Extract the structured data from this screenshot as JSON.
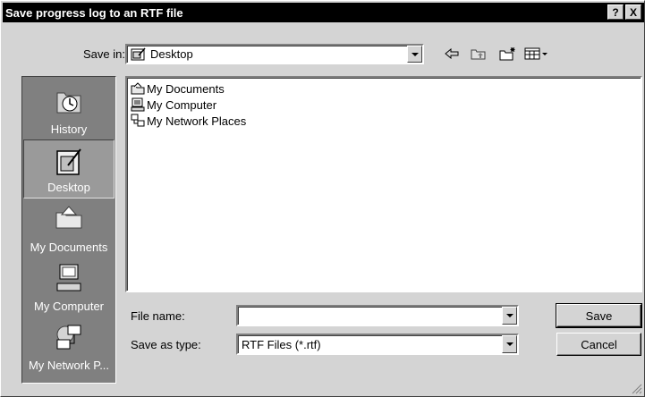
{
  "window": {
    "title": "Save progress log to an RTF file"
  },
  "titlebar_buttons": {
    "help": "?",
    "close": "X"
  },
  "save_in": {
    "label": "Save in:",
    "value": "Desktop"
  },
  "toolbar_icons": [
    "back-arrow-icon",
    "up-folder-icon",
    "new-folder-icon",
    "view-menu-icon"
  ],
  "places": [
    {
      "label": "History",
      "icon": "history-icon",
      "selected": false
    },
    {
      "label": "Desktop",
      "icon": "desktop-icon",
      "selected": true
    },
    {
      "label": "My Documents",
      "icon": "my-documents-icon",
      "selected": false
    },
    {
      "label": "My Computer",
      "icon": "my-computer-icon",
      "selected": false
    },
    {
      "label": "My Network P...",
      "icon": "network-places-icon",
      "selected": false
    }
  ],
  "files": [
    {
      "name": "My Documents",
      "icon": "folder-icon"
    },
    {
      "name": "My Computer",
      "icon": "computer-icon"
    },
    {
      "name": "My Network Places",
      "icon": "network-icon"
    }
  ],
  "file_name": {
    "label": "File name:",
    "value": ""
  },
  "save_as_type": {
    "label": "Save as type:",
    "value": "RTF Files (*.rtf)"
  },
  "buttons": {
    "save": "Save",
    "cancel": "Cancel"
  }
}
